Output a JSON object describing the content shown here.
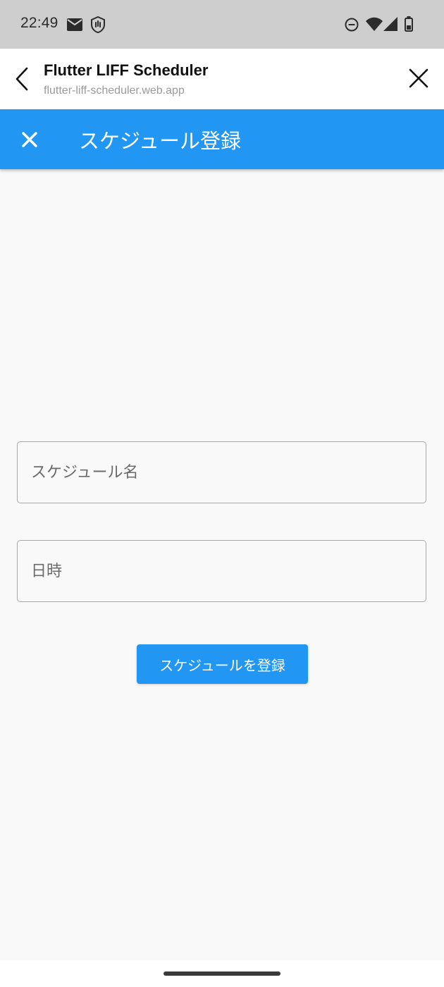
{
  "status_bar": {
    "time": "22:49",
    "left_icons": [
      "mail-icon",
      "shield-hand-icon"
    ],
    "right_icons": [
      "do-not-disturb-icon",
      "wifi-icon",
      "cellular-icon",
      "battery-icon"
    ]
  },
  "browser": {
    "title": "Flutter LIFF Scheduler",
    "url": "flutter-liff-scheduler.web.app",
    "icons": [
      "back-chevron-icon",
      "close-icon"
    ]
  },
  "app_bar": {
    "title": "スケジュール登録",
    "close_icon": "close-icon",
    "color": "#2196f3"
  },
  "form": {
    "name_field": {
      "placeholder": "スケジュール名",
      "value": ""
    },
    "datetime_field": {
      "placeholder": "日時",
      "value": ""
    },
    "submit_label": "スケジュールを登録"
  },
  "colors": {
    "primary": "#2196f3",
    "status_bar": "#cdcecd",
    "background": "#f9f9f9"
  }
}
